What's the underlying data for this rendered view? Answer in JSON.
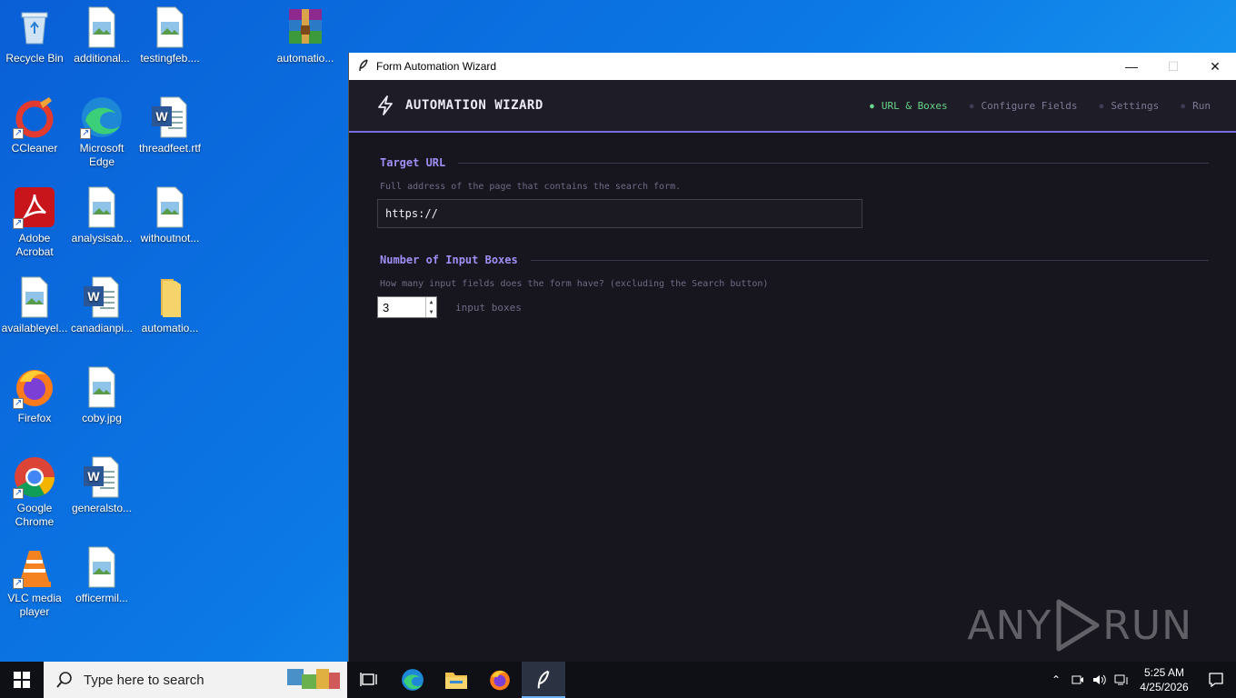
{
  "desktop": {
    "icons": [
      {
        "label": "Recycle Bin",
        "icon": "recycle-bin-icon"
      },
      {
        "label": "additional...",
        "icon": "image-file-icon"
      },
      {
        "label": "testingfeb....",
        "icon": "image-file-icon"
      },
      {
        "label": "automatio...",
        "icon": "winrar-archive-icon"
      },
      {
        "label": "CCleaner",
        "icon": "ccleaner-icon"
      },
      {
        "label": "Microsoft Edge",
        "icon": "edge-icon"
      },
      {
        "label": "threadfeet.rtf",
        "icon": "word-document-icon"
      },
      {
        "label": "Adobe Acrobat",
        "icon": "adobe-acrobat-icon"
      },
      {
        "label": "analysisab...",
        "icon": "image-file-icon"
      },
      {
        "label": "withoutnot...",
        "icon": "image-file-icon"
      },
      {
        "label": "availableyel...",
        "icon": "image-file-icon"
      },
      {
        "label": "canadianpi...",
        "icon": "word-document-icon"
      },
      {
        "label": "automatio...",
        "icon": "folder-icon"
      },
      {
        "label": "Firefox",
        "icon": "firefox-icon"
      },
      {
        "label": "coby.jpg",
        "icon": "image-file-icon"
      },
      {
        "label": "Google Chrome",
        "icon": "chrome-icon"
      },
      {
        "label": "generalsto...",
        "icon": "word-document-icon"
      },
      {
        "label": "VLC media player",
        "icon": "vlc-icon"
      },
      {
        "label": "officermil...",
        "icon": "image-file-icon"
      }
    ]
  },
  "window": {
    "title": "Form Automation Wizard",
    "controls": {
      "minimize": "—",
      "maximize": "☐",
      "close": "✕"
    }
  },
  "wizard": {
    "title": "AUTOMATION WIZARD",
    "steps": [
      {
        "label": "URL & Boxes",
        "active": true
      },
      {
        "label": "Configure Fields",
        "active": false
      },
      {
        "label": "Settings",
        "active": false
      },
      {
        "label": "Run",
        "active": false
      }
    ],
    "accent_color": "#9f8ff5",
    "active_color": "#68d48a"
  },
  "target_url": {
    "title": "Target URL",
    "description": "Full address of the page that contains the search form.",
    "value": "https://"
  },
  "input_boxes": {
    "title": "Number of Input Boxes",
    "description": "How many input fields does the form have? (excluding the Search button)",
    "value": "3",
    "unit": "input boxes"
  },
  "watermark": {
    "left": "ANY",
    "right": "RUN"
  },
  "taskbar": {
    "search_placeholder": "Type here to search",
    "apps": [
      "task-view-icon",
      "edge-icon",
      "file-explorer-icon",
      "firefox-icon",
      "feather-app-icon"
    ],
    "time": "5:25 AM",
    "date": "4/25/2026"
  }
}
